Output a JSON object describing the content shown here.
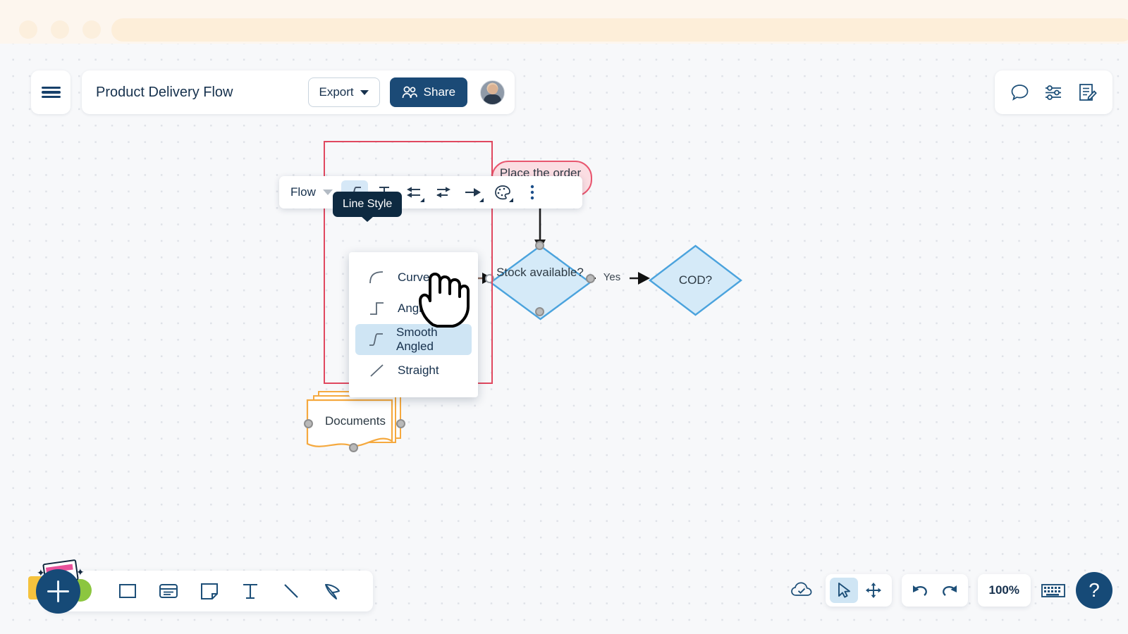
{
  "browser": {
    "dots": [
      "dot-1",
      "dot-2",
      "dot-3"
    ],
    "urlbar_value": ""
  },
  "header": {
    "menu_icon": "hamburger-menu-icon",
    "title": "Product Delivery Flow",
    "export_label": "Export",
    "share_label": "Share",
    "avatar_alt": "user-avatar"
  },
  "topright": {
    "comment_icon": "comment-bubble-icon",
    "settings_icon": "sliders-icon",
    "notes_icon": "note-edit-icon"
  },
  "shape_toolbar": {
    "flow_label": "Flow",
    "buttons": [
      {
        "name": "line-style-button",
        "icon": "line-style-icon",
        "active": true
      },
      {
        "name": "text-format-button",
        "icon": "text-icon",
        "active": false
      },
      {
        "name": "line-start-button",
        "icon": "arrow-left-pair-icon",
        "active": false
      },
      {
        "name": "line-end-button",
        "icon": "arrow-right-pair-icon",
        "active": false
      },
      {
        "name": "arrow-head-button",
        "icon": "arrow-head-icon",
        "active": false
      },
      {
        "name": "color-palette-button",
        "icon": "palette-icon",
        "active": false
      },
      {
        "name": "more-options-button",
        "icon": "kebab-menu-icon",
        "active": false
      }
    ]
  },
  "tooltip": {
    "text": "Line Style"
  },
  "line_style_menu": {
    "items": [
      {
        "label": "Curved",
        "icon": "curve-line-icon",
        "selected": false
      },
      {
        "label": "Angled",
        "icon": "angled-line-icon",
        "selected": false
      },
      {
        "label": "Smooth Angled",
        "icon": "smooth-angled-line-icon",
        "selected": true
      },
      {
        "label": "Straight",
        "icon": "straight-line-icon",
        "selected": false
      }
    ]
  },
  "diagram": {
    "nodes": [
      {
        "id": "place-the-order",
        "label": "Place the order",
        "shape": "rounded-rect",
        "fill": "#fbdde2",
        "stroke": "#e8566f"
      },
      {
        "id": "stock-available",
        "label": "Stock available?",
        "shape": "diamond",
        "fill": "#d5eaf8",
        "stroke": "#4ba3dd"
      },
      {
        "id": "cod",
        "label": "COD?",
        "shape": "diamond",
        "fill": "#d5eaf8",
        "stroke": "#4ba3dd"
      },
      {
        "id": "documents",
        "label": "Documents",
        "shape": "multi-document",
        "fill": "#ffffff",
        "stroke": "#f5a93f"
      }
    ],
    "edge_labels": [
      "Yes"
    ],
    "selection_color": "#e0485f"
  },
  "bottom_toolbar": {
    "tools": [
      {
        "name": "rectangle-tool",
        "icon": "square-icon"
      },
      {
        "name": "card-tool",
        "icon": "card-icon"
      },
      {
        "name": "sticky-note-tool",
        "icon": "note-icon"
      },
      {
        "name": "text-tool",
        "icon": "text-t-icon"
      },
      {
        "name": "line-tool",
        "icon": "diagonal-line-icon"
      },
      {
        "name": "pen-tool",
        "icon": "pen-icon"
      }
    ],
    "add_button_label": "+"
  },
  "bottom_right": {
    "save_icon": "cloud-check-icon",
    "select_tool_icon": "cursor-arrow-icon",
    "pan_tool_icon": "move-arrows-icon",
    "undo_icon": "undo-arrow-icon",
    "redo_icon": "redo-arrow-icon",
    "zoom_level": "100%",
    "keyboard_icon": "keyboard-icon",
    "help_label": "?"
  },
  "colors": {
    "brand_dark_blue": "#164a77",
    "accent_red": "#e0485f",
    "node_blue_fill": "#d5eaf8",
    "node_blue_stroke": "#4ba3dd",
    "node_pink_fill": "#fbdde2",
    "node_orange_stroke": "#f5a93f",
    "menu_selected": "#cfe5f4",
    "tooltip_bg": "#0e2a41",
    "canvas_bg": "#f7f8fa"
  }
}
